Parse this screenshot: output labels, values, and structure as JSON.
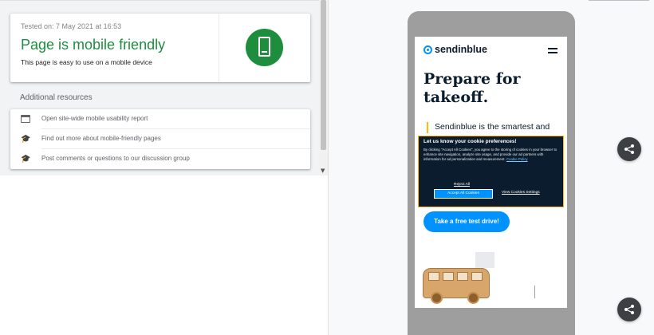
{
  "result": {
    "tested_on": "Tested on: 7 May 2021 at 16:53",
    "title": "Page is mobile friendly",
    "description": "This page is easy to use on a mobile device",
    "status_color": "#1e8e3e"
  },
  "additional": {
    "title": "Additional resources",
    "items": [
      {
        "icon": "browser-window-icon",
        "label": "Open site-wide mobile usability report"
      },
      {
        "icon": "school-cap-icon",
        "label": "Find out more about mobile-friendly pages"
      },
      {
        "icon": "school-cap-icon",
        "label": "Post comments or questions to our discussion group"
      }
    ]
  },
  "preview": {
    "brand": "sendinblue",
    "hero_title": "Prepare for takeoff.",
    "hero_text": "Sendinblue is the smartest and",
    "cta": "Take a free test drive!",
    "brand_color": "#0092ff",
    "cookie": {
      "title": "Let us know your cookie preferences!",
      "body": "By clicking \"Accept All Cookies\", you agree to the storing of cookies in your browser to enhance site navigation, analyze site usage, and provide our ad partners with information for ad personalization and measurement.",
      "policy_link": "Cookie Policy",
      "reject": "Reject All",
      "accept": "Accept All Cookies",
      "view": "View Cookies Settings"
    }
  },
  "share": {
    "icon": "share-icon"
  }
}
